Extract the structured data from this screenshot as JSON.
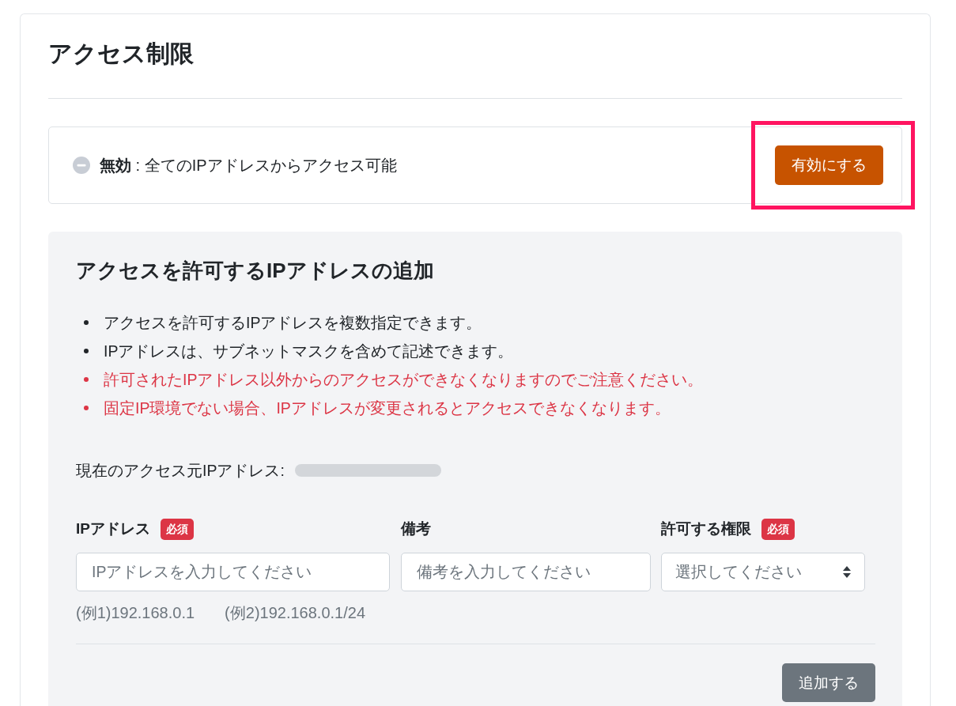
{
  "page": {
    "title": "アクセス制限"
  },
  "status": {
    "enabled": false,
    "text": "**無効** : 全てのIPアドレスからアクセス可能",
    "button": {
      "label": "有効にする",
      "highlighted": true
    }
  },
  "panel": {
    "title": "アクセスを許可するIPアドレスの追加",
    "notes": [
      {
        "kind": "info",
        "text": "アクセスを許可するIPアドレスを複数指定できます。"
      },
      {
        "kind": "info",
        "text": "IPアドレスは、サブネットマスクを含めて記述できます。"
      },
      {
        "kind": "warning",
        "text": "許可されたIPアドレス以外からのアクセスができなくなりますのでご注意ください。"
      },
      {
        "kind": "warning",
        "text": "固定IP環境でない場合、IPアドレスが変更されるとアクセスできなくなります。"
      }
    ],
    "current_ip": {
      "label": "現在のアクセス元IPアドレス:",
      "value_blurred": true
    },
    "fields": [
      {
        "kind": "text",
        "label": "IPアドレス",
        "required": true,
        "required_badge": "必須",
        "placeholder": "IPアドレスを入力してください"
      },
      {
        "kind": "text",
        "label": "備考",
        "required": false,
        "placeholder": "備考を入力してください"
      },
      {
        "kind": "select",
        "label": "許可する権限",
        "required": true,
        "required_badge": "必須",
        "placeholder": "選択してください"
      }
    ],
    "examples": [
      "(例1)192.168.0.1",
      "(例2)192.168.0.1/24"
    ],
    "submit": {
      "label": "追加する"
    }
  }
}
